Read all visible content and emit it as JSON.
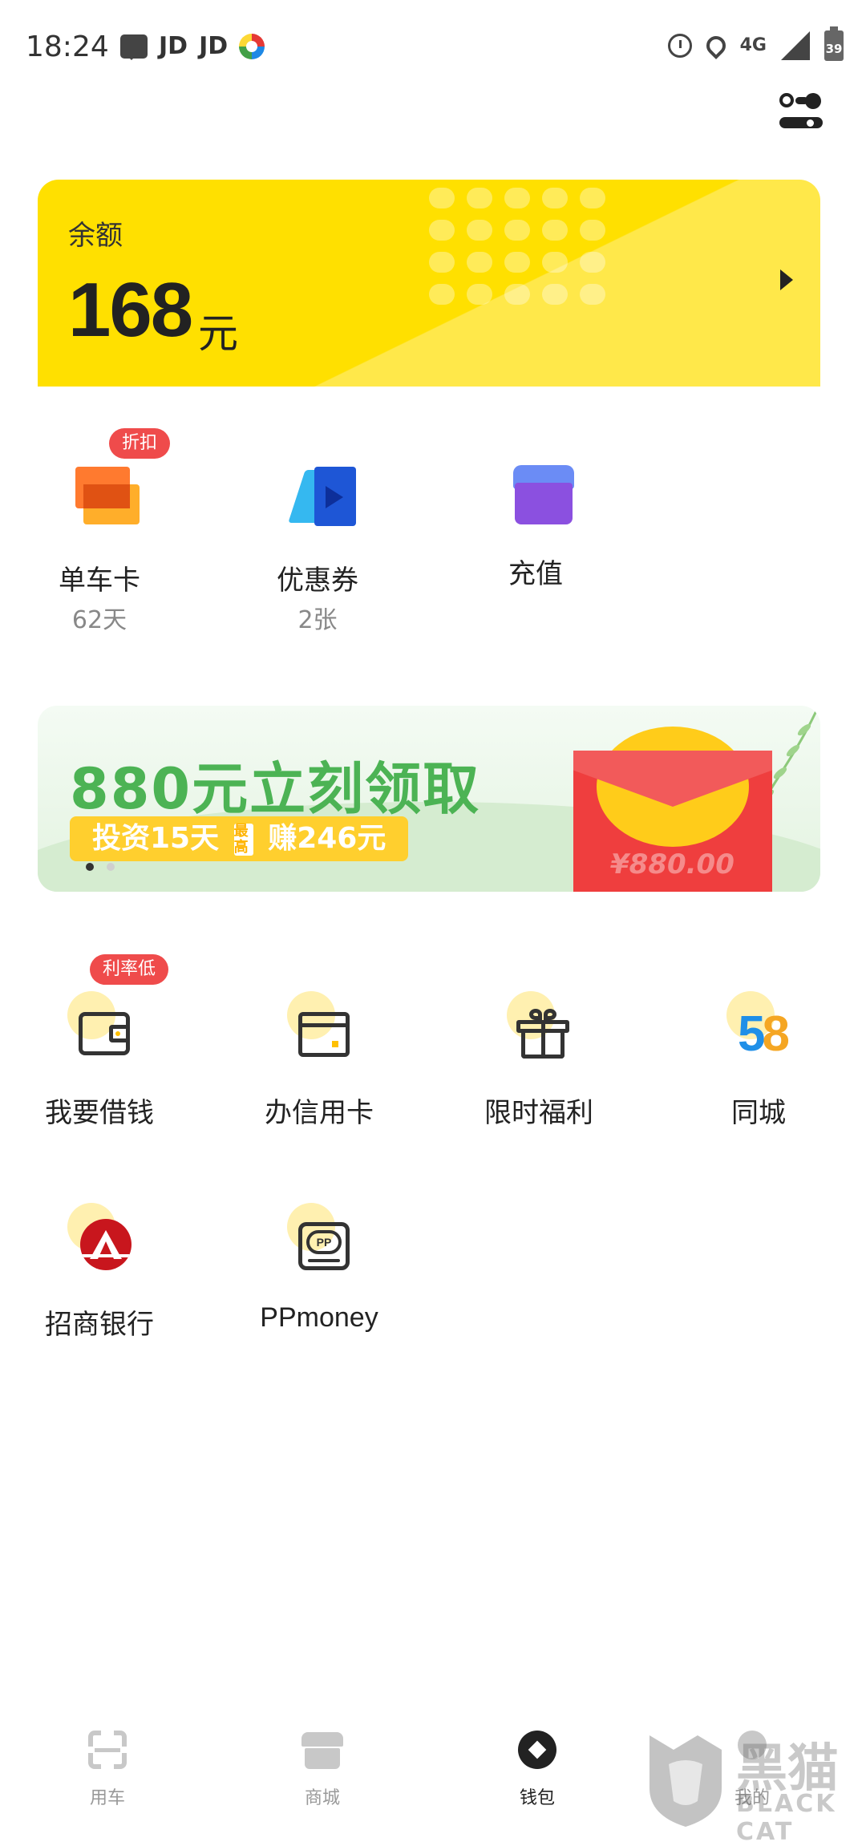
{
  "status_bar": {
    "time": "18:24",
    "notif_1": "JD",
    "notif_2": "JD",
    "network": "4G",
    "battery": "39"
  },
  "balance": {
    "label": "余额",
    "amount": "168",
    "unit": "元"
  },
  "shortcuts": [
    {
      "label": "单车卡",
      "sub": "62天",
      "badge": "折扣",
      "icon": "bike-card-icon"
    },
    {
      "label": "优惠券",
      "sub": "2张",
      "icon": "coupon-icon"
    },
    {
      "label": "充值",
      "icon": "recharge-store-icon"
    }
  ],
  "banner": {
    "title": "880元立刻领取",
    "subtitle_a": "投资15天",
    "subtitle_tag": "最高",
    "subtitle_b": "赚246元",
    "envelope_amount": "¥880.00",
    "page_count": 2,
    "active_page": 0
  },
  "services": [
    {
      "label": "我要借钱",
      "badge": "利率低",
      "icon": "wallet-icon"
    },
    {
      "label": "办信用卡",
      "icon": "credit-card-icon"
    },
    {
      "label": "限时福利",
      "icon": "gift-icon"
    },
    {
      "label": "同城",
      "icon": "58-tongcheng-icon"
    },
    {
      "label": "招商银行",
      "icon": "cmb-bank-icon"
    },
    {
      "label": "PPmoney",
      "icon": "ppmoney-icon"
    }
  ],
  "bottom_nav": [
    {
      "label": "用车",
      "icon": "scan-icon",
      "active": false
    },
    {
      "label": "商城",
      "icon": "shop-icon",
      "active": false
    },
    {
      "label": "钱包",
      "icon": "wallet-diamond-icon",
      "active": true
    },
    {
      "label": "我的",
      "icon": "profile-icon",
      "active": false
    }
  ],
  "watermark": {
    "cn": "黑猫",
    "en": "BLACK CAT"
  },
  "colors": {
    "brand_yellow": "#ffe000",
    "badge_red": "#ef4b4b",
    "banner_green": "#4cb354"
  }
}
